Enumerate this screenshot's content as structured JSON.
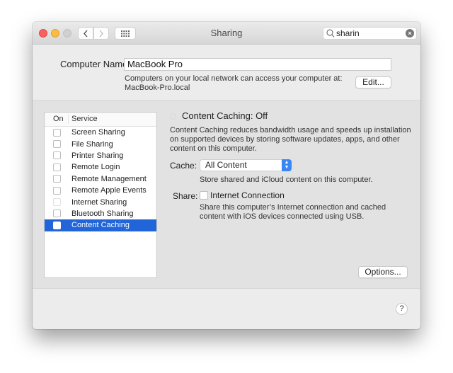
{
  "window": {
    "title": "Sharing",
    "search": {
      "value": "sharin",
      "placeholder": "Search"
    },
    "icons": {
      "back": "chevron-left-icon",
      "forward": "chevron-right-icon",
      "grid": "grid-icon",
      "search": "magnifier-icon",
      "clear": "clear-icon"
    }
  },
  "computer": {
    "label": "Computer Name:",
    "name": "MacBook Pro",
    "access_text": "Computers on your local network can access your computer at:",
    "hostname": "MacBook-Pro.local",
    "edit_label": "Edit..."
  },
  "services": {
    "headers": {
      "on": "On",
      "service": "Service"
    },
    "items": [
      {
        "name": "Screen Sharing",
        "on": false,
        "enabled": true,
        "selected": false
      },
      {
        "name": "File Sharing",
        "on": false,
        "enabled": true,
        "selected": false
      },
      {
        "name": "Printer Sharing",
        "on": false,
        "enabled": true,
        "selected": false
      },
      {
        "name": "Remote Login",
        "on": false,
        "enabled": true,
        "selected": false
      },
      {
        "name": "Remote Management",
        "on": false,
        "enabled": true,
        "selected": false
      },
      {
        "name": "Remote Apple Events",
        "on": false,
        "enabled": true,
        "selected": false
      },
      {
        "name": "Internet Sharing",
        "on": false,
        "enabled": false,
        "selected": false
      },
      {
        "name": "Bluetooth Sharing",
        "on": false,
        "enabled": true,
        "selected": false
      },
      {
        "name": "Content Caching",
        "on": false,
        "enabled": true,
        "selected": true
      }
    ]
  },
  "detail": {
    "status": "Content Caching: Off",
    "description": "Content Caching reduces bandwidth usage and speeds up installation on supported devices by storing software updates, apps, and other content on this computer.",
    "cache_label": "Cache:",
    "cache_value": "All Content",
    "cache_note": "Store shared and iCloud content on this computer.",
    "share_label": "Share:",
    "share_option": "Internet Connection",
    "share_checked": false,
    "share_note": "Share this computer’s Internet connection and cached content with iOS devices connected using USB.",
    "options_label": "Options..."
  },
  "help_label": "?",
  "colors": {
    "selection": "#2165d8",
    "close": "#fc605c",
    "minimize": "#fdbc40",
    "popup_arrow": "#3b86f5"
  }
}
